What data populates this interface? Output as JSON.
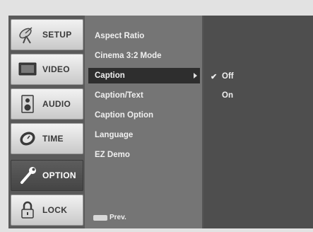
{
  "categories": [
    {
      "label": "SETUP",
      "icon": "satellite-dish-icon"
    },
    {
      "label": "VIDEO",
      "icon": "tv-screen-icon"
    },
    {
      "label": "AUDIO",
      "icon": "speaker-icon"
    },
    {
      "label": "TIME",
      "icon": "clock-icon"
    },
    {
      "label": "OPTION",
      "icon": "wrench-icon",
      "active": true
    },
    {
      "label": "LOCK",
      "icon": "padlock-icon"
    }
  ],
  "submenu": {
    "items": [
      {
        "label": "Aspect Ratio"
      },
      {
        "label": "Cinema 3:2 Mode"
      },
      {
        "label": "Caption",
        "selected": true,
        "has_arrow": true
      },
      {
        "label": "Caption/Text"
      },
      {
        "label": "Caption Option"
      },
      {
        "label": "Language"
      },
      {
        "label": "EZ Demo"
      }
    ],
    "prev_label": "Prev."
  },
  "options": {
    "items": [
      {
        "label": "Off",
        "checked": true
      },
      {
        "label": "On",
        "checked": false
      }
    ],
    "check_glyph": "✔"
  },
  "colors": {
    "screen_bg": "#606060",
    "selected_bg": "#2e2e2e",
    "text": "#f0f0f0"
  }
}
